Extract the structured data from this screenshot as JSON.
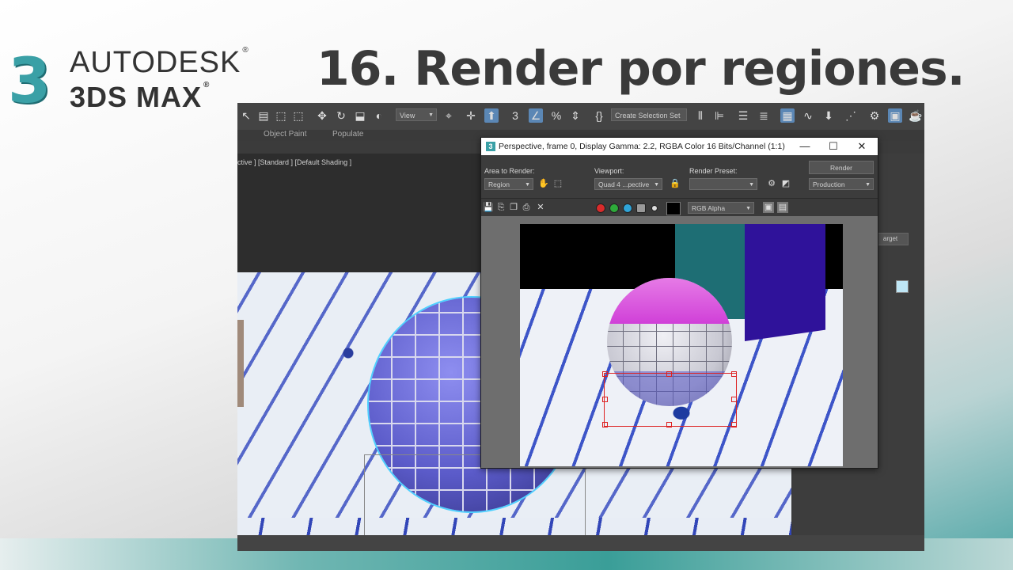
{
  "branding": {
    "logo_mark": "3",
    "logo_line1": "AUTODESK",
    "logo_line2": "3DS MAX",
    "trademark": "®",
    "title": "16. Render por regiones.",
    "accent_color": "#3aa0a6"
  },
  "app": {
    "toolbar": {
      "view_dropdown": "View",
      "selection_set_placeholder": "Create Selection Set",
      "icons": [
        "select-icon",
        "select-region-icon",
        "window-crossing-icon",
        "move-icon",
        "rotate-icon",
        "scale-icon",
        "selection-filter-icon",
        "view-icon",
        "pivot-icon",
        "snap-icon",
        "angle-snap-icon",
        "percent-snap-icon",
        "spinner-snap-icon",
        "edit-named-selection-icon",
        "mirror-icon",
        "align-icon",
        "layer-explorer-icon",
        "scene-explorer-icon",
        "schematic-view-icon",
        "curve-editor-icon",
        "render-setup-icon",
        "rendered-frame-window-icon",
        "render-icon"
      ]
    },
    "ribbon": {
      "object_paint": "Object Paint",
      "populate": "Populate"
    },
    "viewport_label": "ctive ] [Standard ] [Default Shading ]",
    "right_panel": {
      "target_label": "arget"
    }
  },
  "render_window": {
    "title": "Perspective, frame 0, Display Gamma: 2.2, RGBA Color 16 Bits/Channel (1:1)",
    "area_to_render_label": "Area to Render:",
    "area_to_render_value": "Region",
    "viewport_label": "Viewport:",
    "viewport_value": "Quad 4 ...pective",
    "render_preset_label": "Render Preset:",
    "render_preset_value": "",
    "render_button": "Render",
    "render_mode_value": "Production",
    "channel_value": "RGB Alpha",
    "channel_colors": {
      "red": "#d92b2b",
      "green": "#2eaa3a",
      "blue": "#2fa4d8"
    },
    "controls": {
      "minimize": "—",
      "maximize": "☐",
      "close": "✕"
    }
  }
}
